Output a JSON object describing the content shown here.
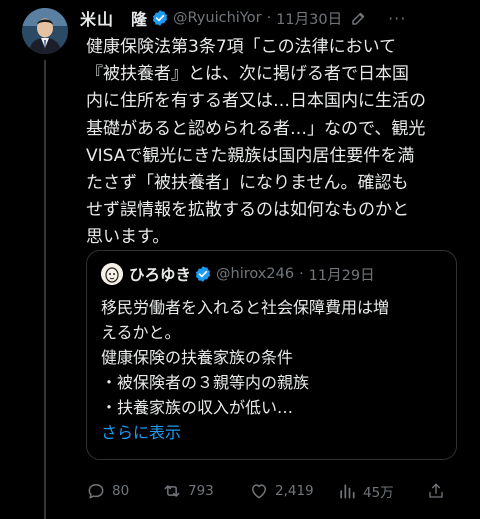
{
  "author": {
    "name": "米山　隆",
    "handle": "@RyuichiYor",
    "separator": "·",
    "date": "11月30日",
    "more": "···"
  },
  "tweet": {
    "lines": [
      "健康保険法第3条7項「この法律において",
      "『被扶養者』とは、次に掲げる者で日本国",
      "内に住所を有する者又は…日本国内に生活の",
      "基礎があると認められる者…」なので、観光",
      "VISAで観光にきた親族は国内居住要件を満",
      "たさず「被扶養者」になりません。確認も",
      "せず誤情報を拡散するのは如何なものかと",
      "思います。"
    ]
  },
  "quote": {
    "name": "ひろゆき",
    "handle": "@hirox246",
    "separator": "·",
    "date": "11月29日",
    "lines": [
      "移民労働者を入れると社会保障費用は増",
      "えるかと。",
      "健康保険の扶養家族の条件",
      "・被保険者の３親等内の親族",
      "・扶養家族の収入が低い…"
    ],
    "show_more": "さらに表示"
  },
  "actions": {
    "replies": "80",
    "reposts": "793",
    "likes": "2,419",
    "views": "45万"
  },
  "colors": {
    "background": "#000000",
    "text": "#e7e9ea",
    "muted": "#71767b",
    "accent": "#1d9bf0",
    "border": "#2f3336"
  }
}
